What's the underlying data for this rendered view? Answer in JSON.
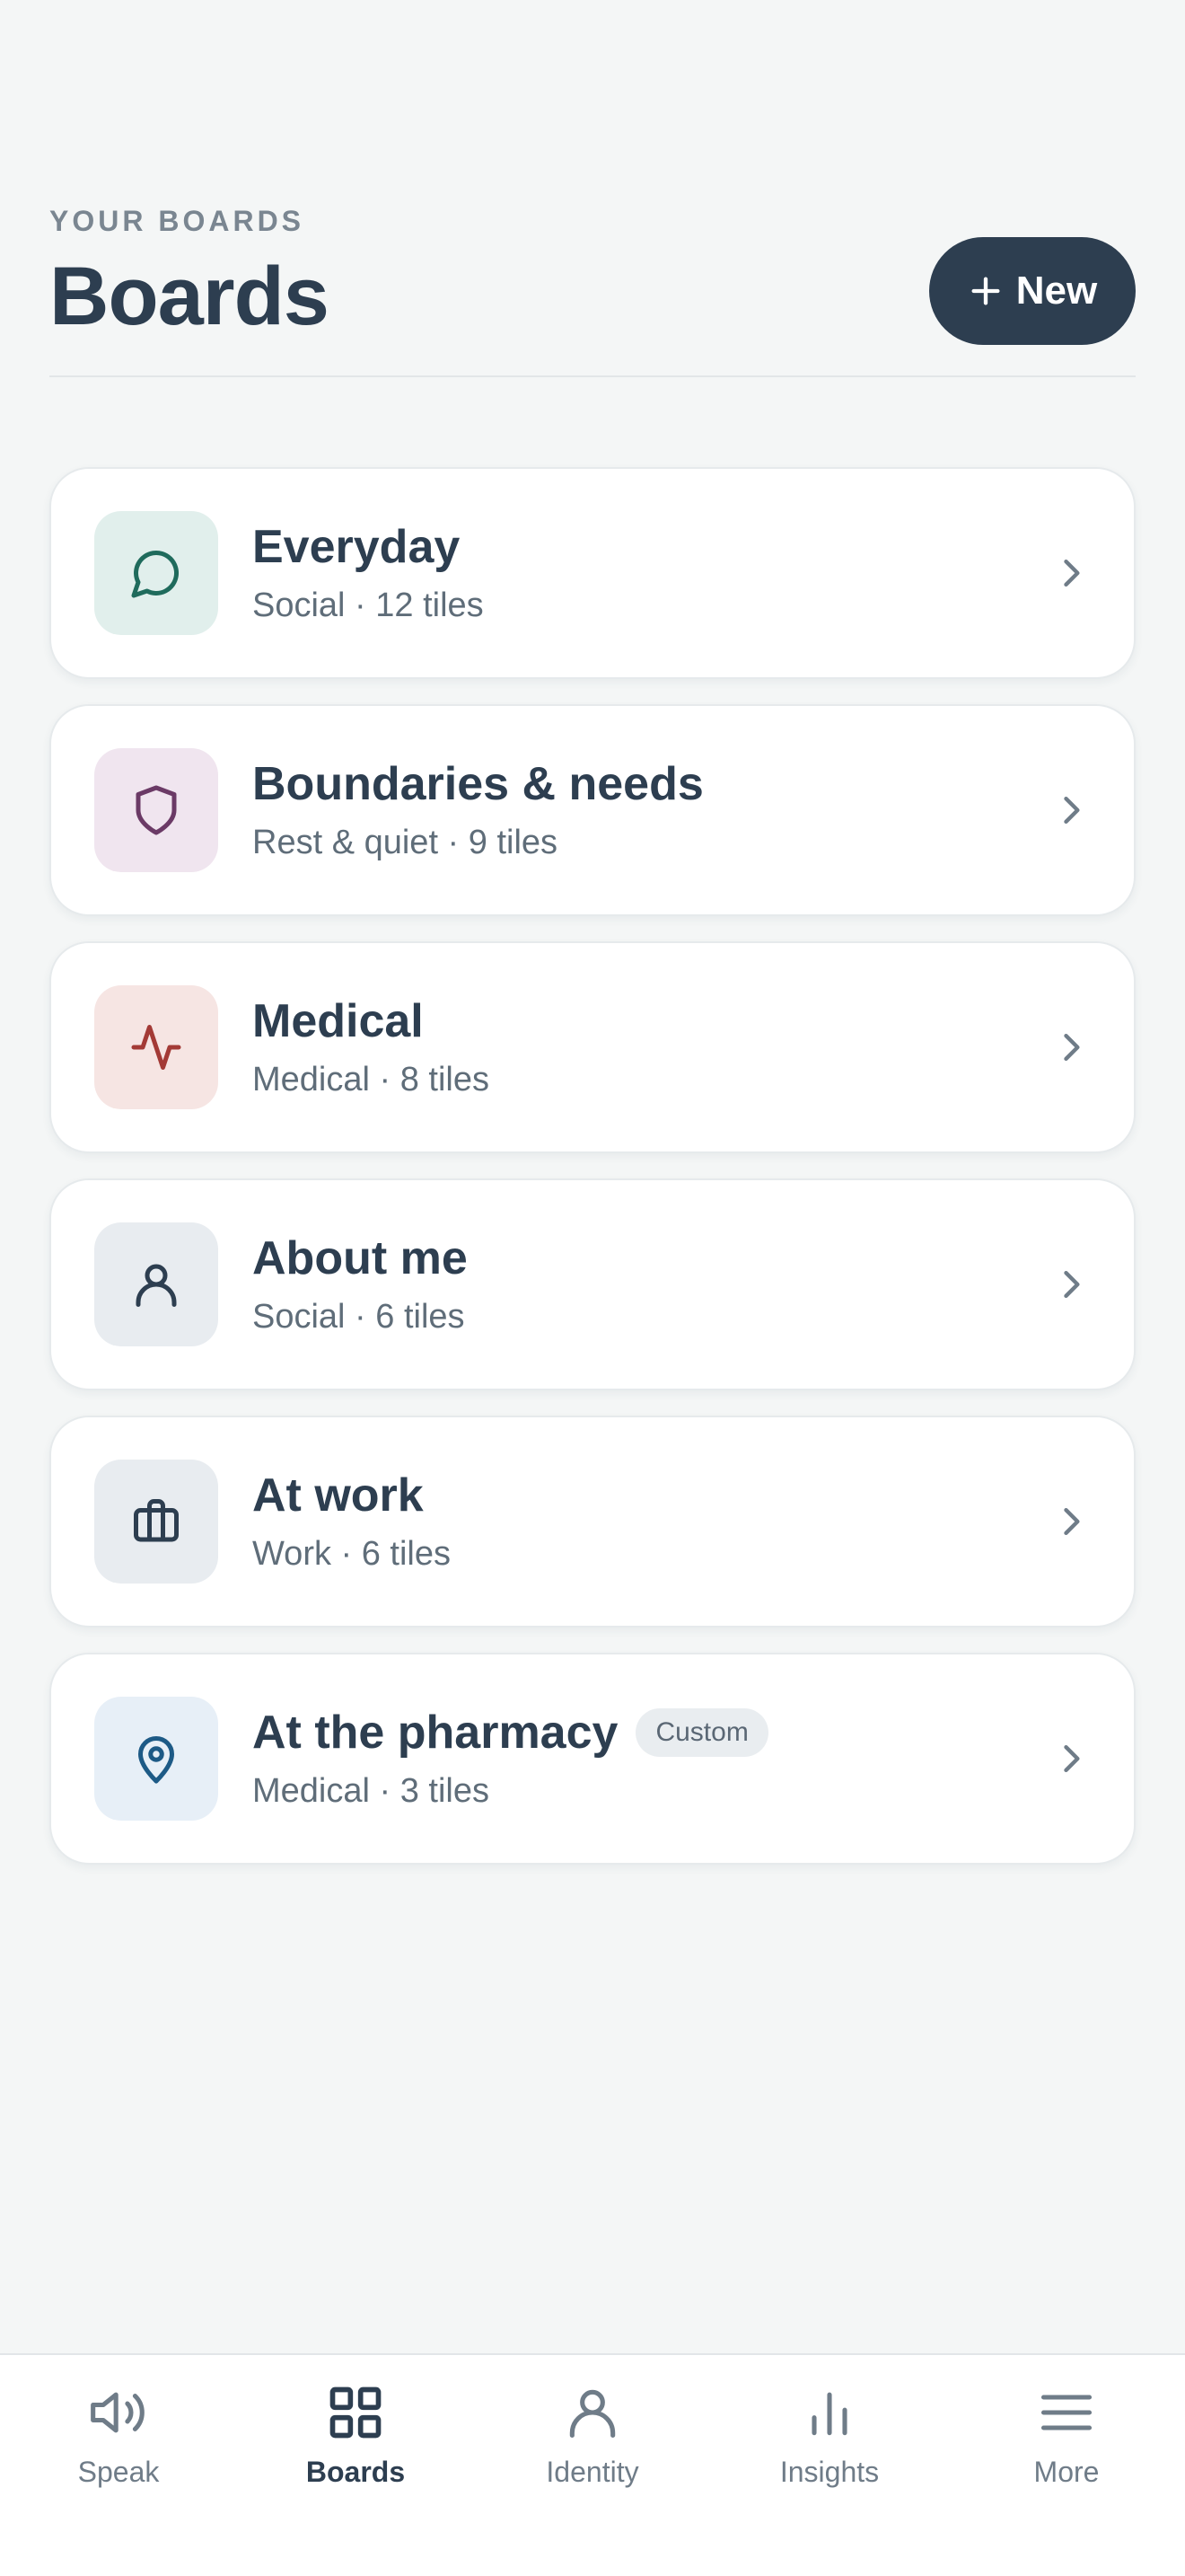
{
  "header": {
    "eyebrow": "YOUR BOARDS",
    "title": "Boards",
    "new_button_label": "New"
  },
  "boards": [
    {
      "title": "Everyday",
      "subtitle": "Social · 12 tiles",
      "icon": "speech-bubble-icon",
      "icon_bg": "#e1efec",
      "icon_color": "#1f6b5c"
    },
    {
      "title": "Boundaries & needs",
      "subtitle": "Rest & quiet · 9 tiles",
      "icon": "shield-icon",
      "icon_bg": "#f0e5ef",
      "icon_color": "#6b3a66"
    },
    {
      "title": "Medical",
      "subtitle": "Medical · 8 tiles",
      "icon": "pulse-icon",
      "icon_bg": "#f6e5e3",
      "icon_color": "#a33a36"
    },
    {
      "title": "About me",
      "subtitle": "Social · 6 tiles",
      "icon": "person-icon",
      "icon_bg": "#e8ecf0",
      "icon_color": "#2d3e50"
    },
    {
      "title": "At work",
      "subtitle": "Work · 6 tiles",
      "icon": "briefcase-icon",
      "icon_bg": "#e8ecf0",
      "icon_color": "#2d3e50"
    },
    {
      "title": "At the pharmacy",
      "subtitle": "Medical · 3 tiles",
      "badge": "Custom",
      "icon": "map-pin-icon",
      "icon_bg": "#e7eff7",
      "icon_color": "#1d5a86"
    }
  ],
  "nav": {
    "items": [
      {
        "label": "Speak",
        "icon": "speaker-icon"
      },
      {
        "label": "Boards",
        "icon": "grid-icon",
        "active": true
      },
      {
        "label": "Identity",
        "icon": "person-icon"
      },
      {
        "label": "Insights",
        "icon": "bar-chart-icon"
      },
      {
        "label": "More",
        "icon": "menu-icon"
      }
    ]
  },
  "colors": {
    "background": "#f4f6f6",
    "primary": "#2d3e50",
    "muted": "#6f7c88"
  }
}
